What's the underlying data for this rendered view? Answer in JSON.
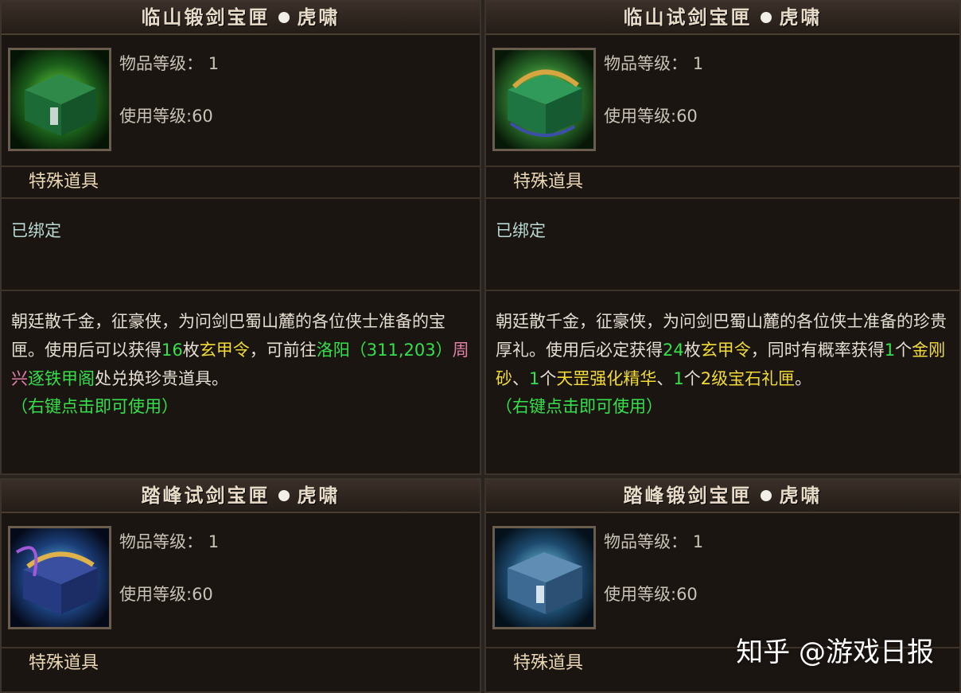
{
  "cards": [
    {
      "title": "临山锻剑宝匣",
      "subtitle": "虎啸",
      "item_level_label": "物品等级：",
      "item_level": "1",
      "use_level": "使用等级:60",
      "category": "特殊道具",
      "bind_status": "已绑定",
      "desc": {
        "p1": "朝廷散千金，征豪侠，为问剑巴蜀山麓的各位侠士准备的宝匣。使用后可以获得",
        "n1": "16",
        "u1": "枚",
        "item": "玄甲令",
        "p2": "，可前往",
        "place": "洛阳（311,203）",
        "npc": "周兴",
        "shop": "逐铁甲阁",
        "p3": "处兑换珍贵道具。"
      },
      "hint": "（右键点击即可使用）",
      "icon": "green-treasure-chest-icon"
    },
    {
      "title": "临山试剑宝匣",
      "subtitle": "虎啸",
      "item_level_label": "物品等级：",
      "item_level": "1",
      "use_level": "使用等级:60",
      "category": "特殊道具",
      "bind_status": "已绑定",
      "desc": {
        "p1": "朝廷散千金，征豪侠，为问剑巴蜀山麓的各位侠士准备的珍贵厚礼。使用后必定获得",
        "n1": "24",
        "u1": "枚",
        "item": "玄甲令",
        "p2": "，同时有概率获得",
        "n2": "1",
        "u2": "个",
        "item2": "金刚砂",
        "sep1": "、",
        "n3": "1",
        "u3": "个",
        "item3": "天罡强化精华",
        "sep2": "、",
        "n4": "1",
        "u4": "个",
        "item4": "2级宝石礼匣",
        "end": "。"
      },
      "hint": "（右键点击即可使用）",
      "icon": "green-gold-treasure-chest-icon"
    },
    {
      "title": "踏峰试剑宝匣",
      "subtitle": "虎啸",
      "item_level_label": "物品等级：",
      "item_level": "1",
      "use_level": "使用等级:60",
      "category": "特殊道具",
      "icon": "blue-gold-treasure-chest-icon"
    },
    {
      "title": "踏峰锻剑宝匣",
      "subtitle": "虎啸",
      "item_level_label": "物品等级：",
      "item_level": "1",
      "use_level": "使用等级:60",
      "category": "特殊道具",
      "icon": "blue-treasure-chest-icon"
    }
  ],
  "watermark": "知乎 @游戏日报",
  "colors": {
    "highlight_green": "#35e048",
    "highlight_yellow": "#f1dc35",
    "highlight_pink": "#e07fa7",
    "panel_bg": "#1b1512"
  }
}
